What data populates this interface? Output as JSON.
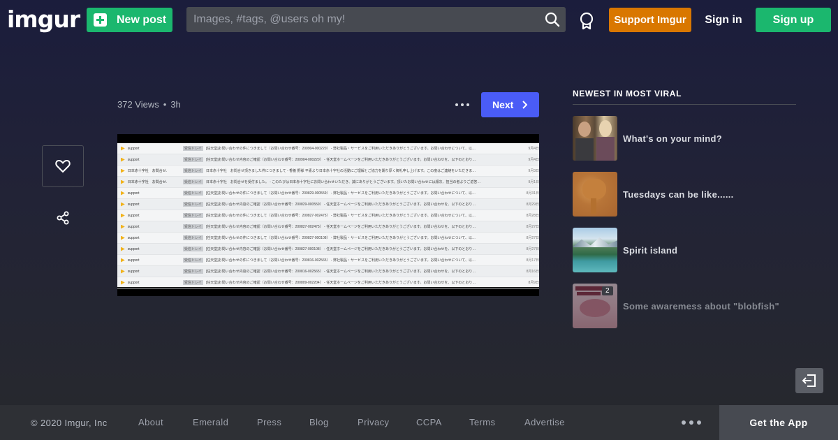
{
  "header": {
    "logo": "imgur",
    "new_post_label": "New post",
    "search_placeholder": "Images, #tags, @users oh my!",
    "support_label": "Support Imgur",
    "signin_label": "Sign in",
    "signup_label": "Sign up",
    "icons": [
      "plus-icon",
      "search-icon",
      "medal-icon"
    ]
  },
  "post": {
    "views": "372 Views",
    "separator": "•",
    "time": "3h",
    "next_label": "Next",
    "icons": [
      "more-icon",
      "chevron-right-icon",
      "heart-icon",
      "share-icon"
    ]
  },
  "screenshot_rows": [
    {
      "sender": "support",
      "tag": "受信トレイ",
      "subject": "[任天堂]お問い合わせの件につきまして（お問い合わせ番号：200904-000220） - 弊社製品・サービスをご利用いただきありがとうございます。お問い合わせについて、以…",
      "date": "9月4日"
    },
    {
      "sender": "support",
      "tag": "受信トレイ",
      "subject": "[任天堂]お問い合わせ内容のご確認（お問い合わせ番号：200904-000220） - 任天堂ホームページをご利用いただきありがとうございます。お問い合わせを、以下のとおり…",
      "date": "9月4日"
    },
    {
      "sender": "日本赤十字社　お問合せ.",
      "tag": "受信トレイ",
      "subject": "日本赤十字社　お問合せ頂きました件につきまして - 香養 野様 平素より日本赤十字社の活動にご理解とご協力を賜り厚く御礼申し上げます。この度はご連絡をいただきま…",
      "date": "9月3日"
    },
    {
      "sender": "日本赤十字社　お問合せ.",
      "tag": "受信トレイ",
      "subject": "日本赤十字社　お問合せを受付ました。 - このたびは日本赤十字社にお問い合わせいただき、誠にありがとうございます。頂いたお問い合わせには順次、担当の者よりご返答…",
      "date": "9月1日"
    },
    {
      "sender": "support",
      "tag": "受信トレイ",
      "subject": "[任天堂]お問い合わせの件につきまして（お問い合わせ番号：200829-000559） - 弊社製品・サービスをご利用いただきありがとうございます。お問い合わせについて、以…",
      "date": "8月31日"
    },
    {
      "sender": "support",
      "tag": "受信トレイ",
      "subject": "[任天堂]お問い合わせ内容のご確認（お問い合わせ番号：200829-000559） - 任天堂ホームページをご利用いただきありがとうございます。お問い合わせを、以下のとおり…",
      "date": "8月29日"
    },
    {
      "sender": "support",
      "tag": "受信トレイ",
      "subject": "[任天堂]お問い合わせの件につきまして（お問い合わせ番号：200827-002475） - 弊社製品・サービスをご利用いただきありがとうございます。お問い合わせについて、以…",
      "date": "8月28日"
    },
    {
      "sender": "support",
      "tag": "受信トレイ",
      "subject": "[任天堂]お問い合わせ内容のご確認（お問い合わせ番号：200827-002475） - 任天堂ホームページをご利用いただきありがとうございます。お問い合わせを、以下のとおり…",
      "date": "8月27日"
    },
    {
      "sender": "support",
      "tag": "受信トレイ",
      "subject": "[任天堂]お問い合わせの件につきまして（お問い合わせ番号：200827-000108） - 弊社製品・サービスをご利用いただきありがとうございます。お問い合わせについて、以…",
      "date": "8月27日"
    },
    {
      "sender": "support",
      "tag": "受信トレイ",
      "subject": "[任天堂]お問い合わせ内容のご確認（お問い合わせ番号：200827-000108） - 任天堂ホームページをご利用いただきありがとうございます。お問い合わせを、以下のとおり…",
      "date": "8月27日"
    },
    {
      "sender": "support",
      "tag": "受信トレイ",
      "subject": "[任天堂]お問い合わせの件につきまして（お問い合わせ番号：200816-002565） - 弊社製品・サービスをご利用いただきありがとうございます。お問い合わせについて、以…",
      "date": "8月17日"
    },
    {
      "sender": "support",
      "tag": "受信トレイ",
      "subject": "[任天堂]お問い合わせ内容のご確認（お問い合わせ番号：200816-002565） - 任天堂ホームページをご利用いただきありがとうございます。お問い合わせを、以下のとおり…",
      "date": "8月16日"
    },
    {
      "sender": "support",
      "tag": "受信トレイ",
      "subject": "[任天堂]お問い合わせ内容のご確認（お問い合わせ番号：200809-002204） - 任天堂ホームページをご利用いただきありがとうございます。お問い合わせを、以下のとおり…",
      "date": "8月9日"
    }
  ],
  "sidebar": {
    "title": "NEWEST IN MOST VIRAL",
    "items": [
      {
        "title": "What's on your mind?",
        "badge": ""
      },
      {
        "title": "Tuesdays can be like......",
        "badge": ""
      },
      {
        "title": "Spirit island",
        "badge": ""
      },
      {
        "title": "Some awaremess about \"blobfish\"",
        "badge": "2"
      }
    ]
  },
  "floating": {
    "icon": "exit-icon"
  },
  "footer": {
    "copyright": "© 2020 Imgur, Inc",
    "links": [
      "About",
      "Emerald",
      "Press",
      "Blog",
      "Privacy",
      "CCPA",
      "Terms",
      "Advertise"
    ],
    "get_app": "Get the App",
    "icons": [
      "more-dots-icon"
    ]
  },
  "colors": {
    "green": "#1bb76e",
    "orange": "#d97700",
    "blue": "#4a5cf6",
    "search_bg": "#474a51",
    "footer_bg": "#2e3035"
  }
}
